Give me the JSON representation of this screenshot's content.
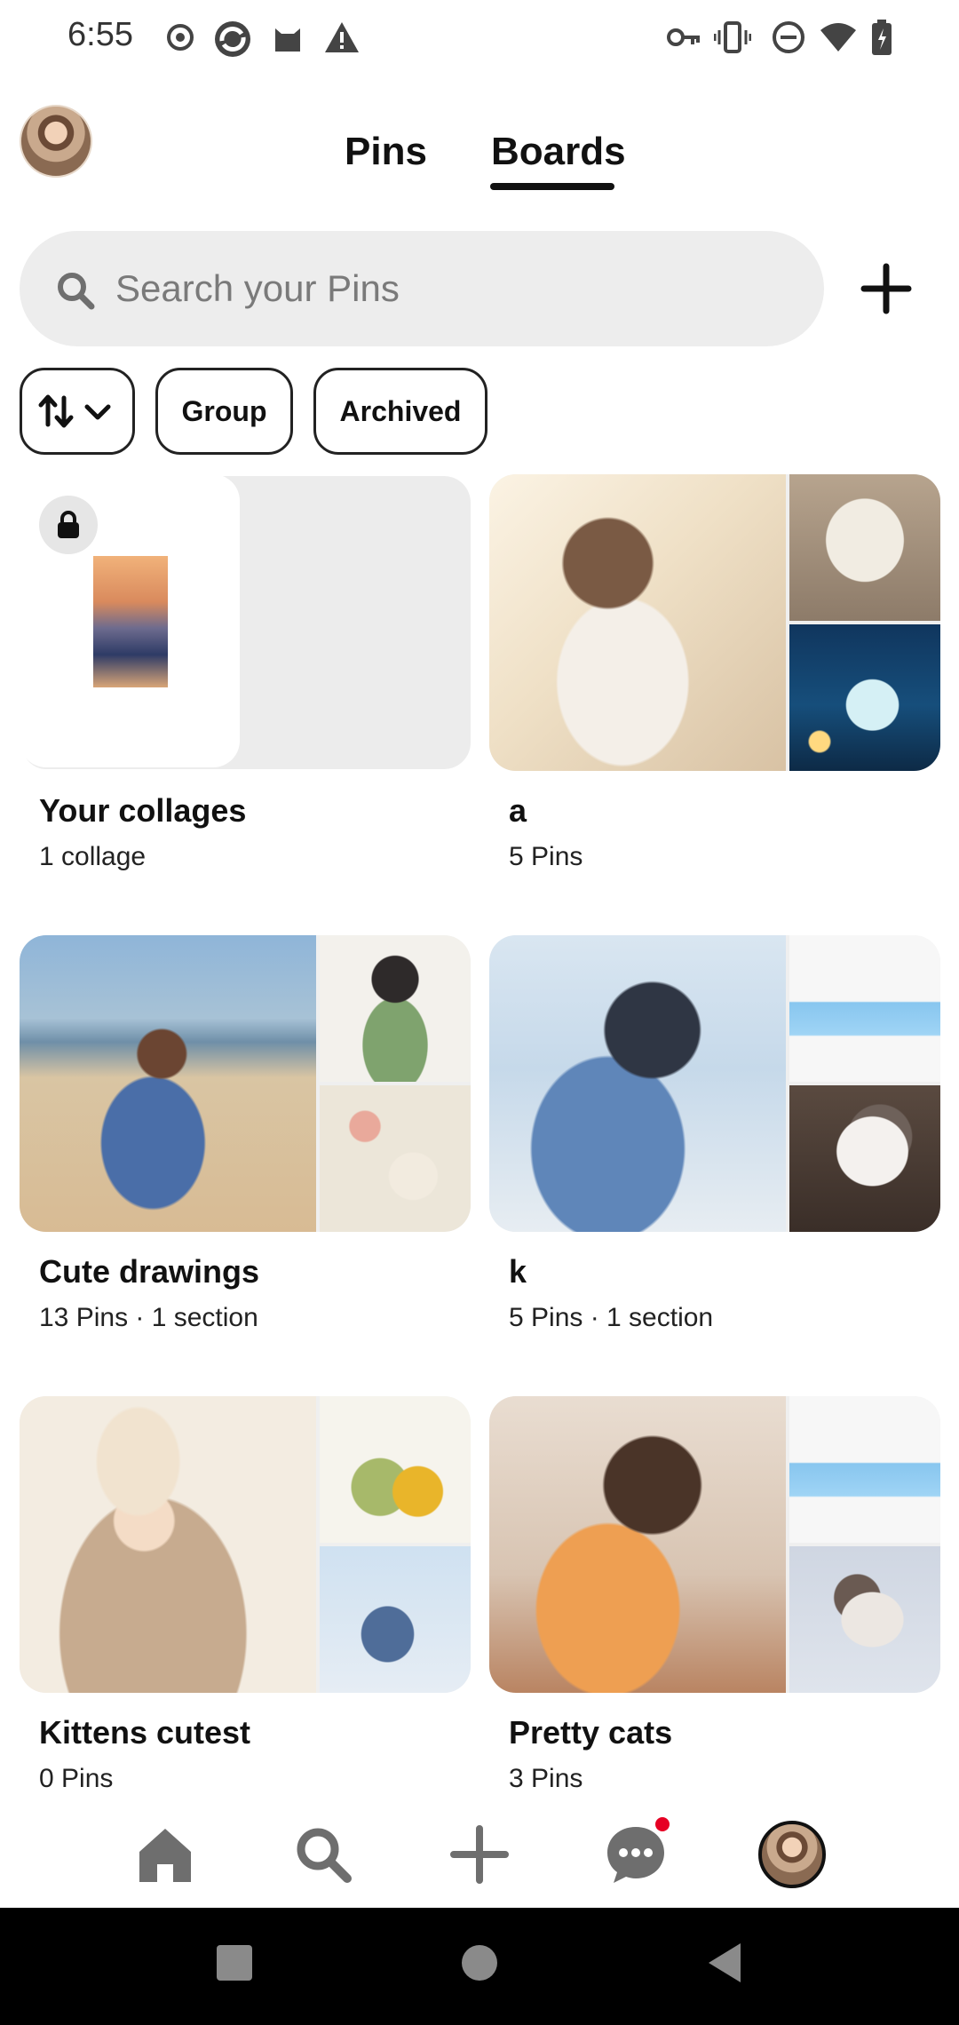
{
  "status_bar": {
    "time": "6:55"
  },
  "header": {
    "tabs": [
      {
        "label": "Pins",
        "active": false
      },
      {
        "label": "Boards",
        "active": true
      }
    ]
  },
  "search": {
    "placeholder": "Search your Pins",
    "value": ""
  },
  "filters": {
    "sort_icon": "sort-arrows-icon",
    "group_label": "Group",
    "archived_label": "Archived"
  },
  "boards": [
    {
      "title": "Your collages",
      "meta": "1 collage"
    },
    {
      "title": "a",
      "meta": "5 Pins"
    },
    {
      "title": "Cute drawings",
      "meta": "13 Pins · 1 section"
    },
    {
      "title": "k",
      "meta": "5 Pins · 1 section"
    },
    {
      "title": "Kittens cutest",
      "meta": "0 Pins"
    },
    {
      "title": "Pretty cats",
      "meta": "3 Pins"
    }
  ],
  "bottom_nav": {
    "items": [
      "home-icon",
      "search-icon",
      "create-icon",
      "messages-icon",
      "profile-avatar"
    ],
    "notification_color": "#e60023"
  },
  "colors": {
    "accent": "#e60023",
    "chip_border": "#222222",
    "search_bg": "#ededed"
  }
}
